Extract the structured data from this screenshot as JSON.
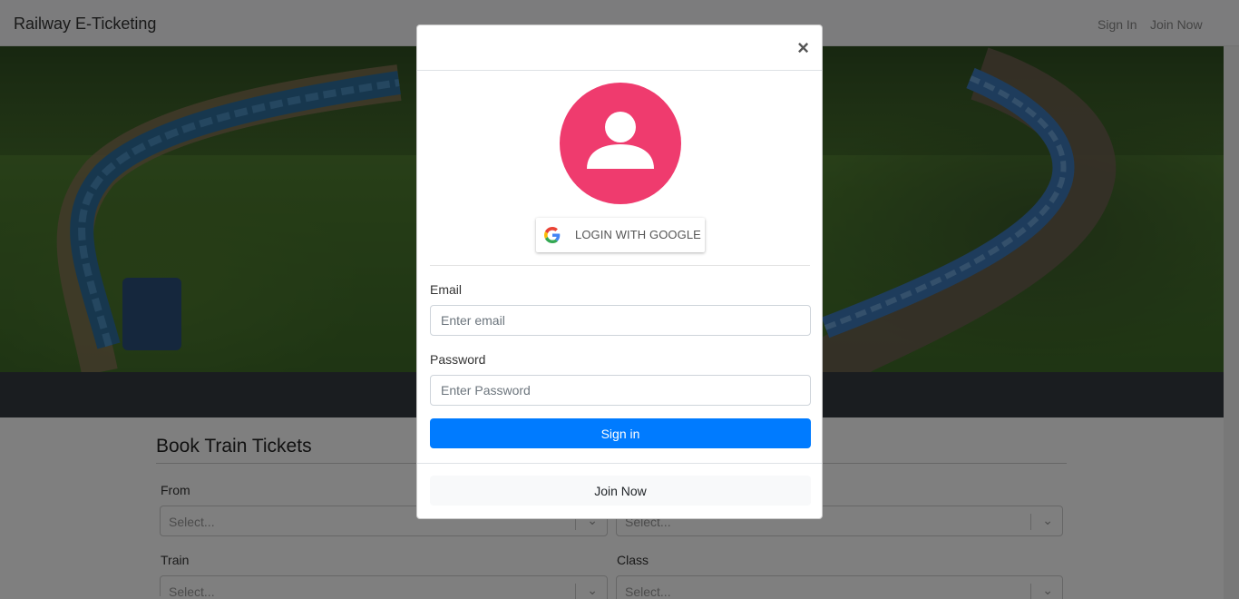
{
  "navbar": {
    "brand": "Railway E-Ticketing",
    "signin_link": "Sign In",
    "join_link": "Join Now"
  },
  "booking": {
    "title": "Book Train Tickets",
    "from_label": "From",
    "train_label": "Train",
    "class_label": "Class",
    "select_placeholder": "Select..."
  },
  "modal": {
    "google_label": "LOGIN WITH GOOGLE",
    "email_label": "Email",
    "email_placeholder": "Enter email",
    "password_label": "Password",
    "password_placeholder": "Enter Password",
    "signin_label": "Sign in",
    "join_label": "Join Now",
    "close_glyph": "×"
  },
  "colors": {
    "primary": "#007bff",
    "avatar": "#ef3b6e",
    "dark_band": "#343a40"
  },
  "icons": {
    "close": "close-icon",
    "avatar": "user-icon",
    "google": "google-icon",
    "chevron": "chevron-down-icon"
  }
}
